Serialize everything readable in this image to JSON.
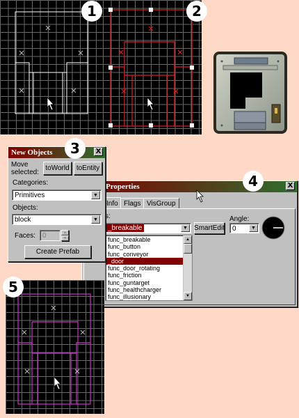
{
  "badges": [
    "1",
    "2",
    "3",
    "4",
    "5"
  ],
  "new_objects": {
    "title": "New Objects",
    "close": "X",
    "move_selected": "Move selected:",
    "to_world": "toWorld",
    "to_entity": "toEntity",
    "categories_label": "Categories:",
    "categories_value": "Primitives",
    "objects_label": "Objects:",
    "objects_value": "block",
    "faces_label": "Faces:",
    "faces_value": "0",
    "create_prefab": "Create Prefab"
  },
  "properties": {
    "title": "Properties",
    "close": "X",
    "tabs": [
      "Info",
      "Flags",
      "VisGroup"
    ],
    "class_label": "s:",
    "class_value": "_breakable",
    "smartedit": "SmartEdit",
    "angle_label": "Angle:",
    "angle_value": "0",
    "list": [
      "func_breakable",
      "func_button",
      "func_conveyor",
      "_door",
      "func_door_rotating",
      "func_friction",
      "func_guntarget",
      "func_healthcharger",
      "func_illusionary"
    ],
    "selected_index": 3
  },
  "colors": {
    "background": "#ffd9c7",
    "wire_white": "#ffffff",
    "wire_red": "#e02020",
    "wire_magenta": "#cc33cc",
    "selection": "#800000"
  }
}
